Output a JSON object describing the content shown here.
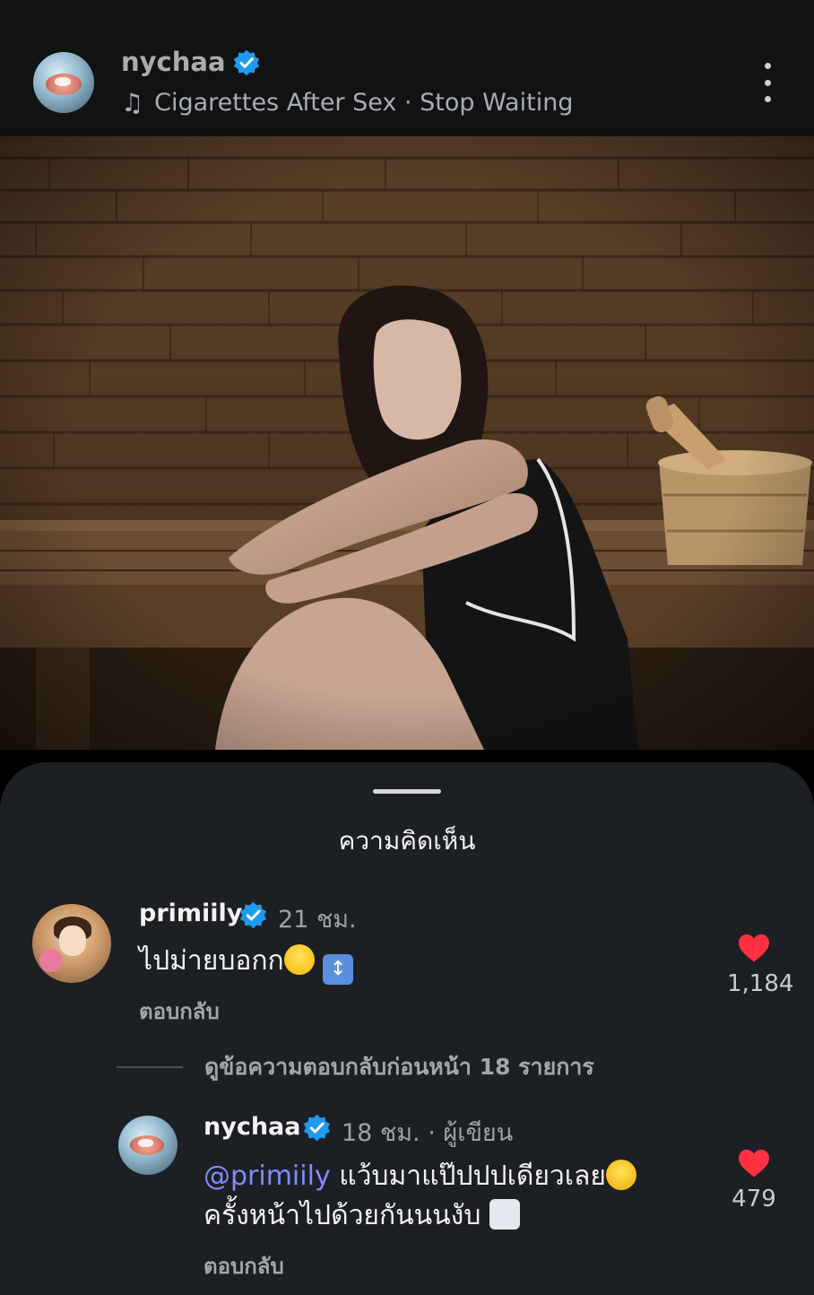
{
  "header": {
    "username": "nychaa",
    "music_icon": "music-note-icon",
    "track": "Cigarettes After Sex · Stop Waiting",
    "more_icon": "more-vertical-icon"
  },
  "sheet": {
    "title": "ความคิดเห็น"
  },
  "comments": [
    {
      "username": "primiily",
      "time": "21 ชม.",
      "text": "ไปม่ายบอกก",
      "reply_label": "ตอบกลับ",
      "likes": "1,184"
    },
    {
      "username": "nychaa",
      "time": "18 ชม.",
      "author_tag": "ผู้เขียน",
      "mention": "@primiily",
      "text_line1": "แว้บมาแป๊ปปปเดียวเลย",
      "text_line2": "ครั้งหน้าไปด้วยกันนนงับ",
      "reply_label": "ตอบกลับ",
      "likes": "479"
    }
  ],
  "view_replies_label": "ดูข้อความตอบกลับก่อนหน้า 18 รายการ",
  "colors": {
    "verified_badge": "#1d9bf0",
    "like_heart": "#ff3040",
    "mention": "#7e8cff",
    "sheet_bg": "#1c1f24"
  }
}
